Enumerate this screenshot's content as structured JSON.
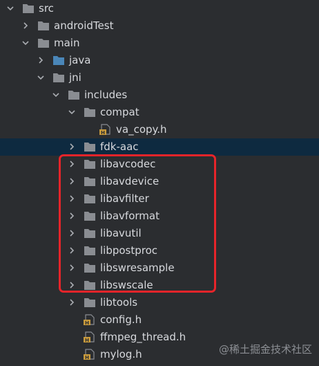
{
  "tree": {
    "items": [
      {
        "label": "src"
      },
      {
        "label": "androidTest"
      },
      {
        "label": "main"
      },
      {
        "label": "java"
      },
      {
        "label": "jni"
      },
      {
        "label": "includes"
      },
      {
        "label": "compat"
      },
      {
        "label": "va_copy.h"
      },
      {
        "label": "fdk-aac"
      },
      {
        "label": "libavcodec"
      },
      {
        "label": "libavdevice"
      },
      {
        "label": "libavfilter"
      },
      {
        "label": "libavformat"
      },
      {
        "label": "libavutil"
      },
      {
        "label": "libpostproc"
      },
      {
        "label": "libswresample"
      },
      {
        "label": "libswscale"
      },
      {
        "label": "libtools"
      },
      {
        "label": "config.h"
      },
      {
        "label": "ffmpeg_thread.h"
      },
      {
        "label": "mylog.h"
      }
    ]
  },
  "colors": {
    "folder": "#8a8d92",
    "java_folder": "#4a86b8",
    "header_file": "#c89a3c",
    "highlight": "#e8242a",
    "selected_row": "#0e2a40"
  },
  "icons": {
    "expanded": "chevron-down-icon",
    "collapsed": "chevron-right-icon",
    "folder": "folder-icon",
    "source_folder": "java-source-folder-icon",
    "header": "header-file-icon"
  },
  "watermark": "@稀土掘金技术社区"
}
